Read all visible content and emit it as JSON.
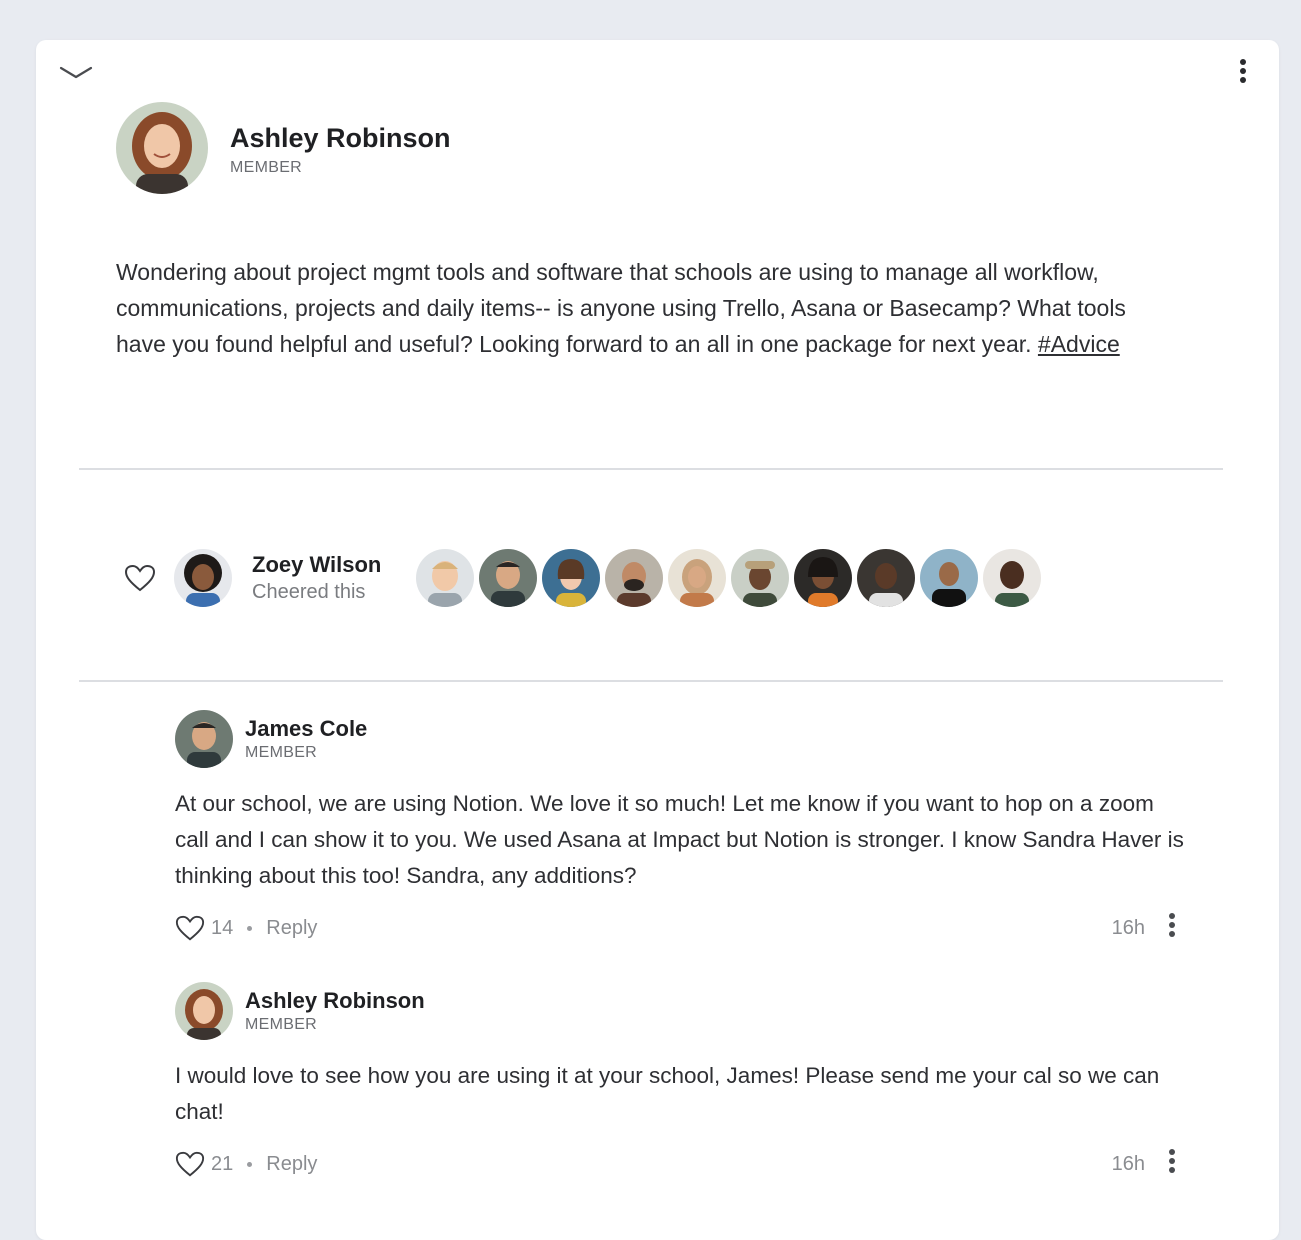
{
  "post": {
    "author": {
      "name": "Ashley Robinson",
      "role": "MEMBER"
    },
    "body": "Wondering about project mgmt tools and software that schools are using to manage all workflow, communications, projects and daily items-- is anyone using Trello, Asana or Basecamp? What tools have you found helpful and useful? Looking forward to an all in one package for next year.",
    "hashtag": "#Advice"
  },
  "cheers": {
    "name": "Zoey Wilson",
    "label": "Cheered this",
    "face_count": 10
  },
  "comments": [
    {
      "name": "James Cole",
      "role": "MEMBER",
      "body": "At our school, we are using Notion. We love it so much! Let me know if you want to hop on a zoom call and I can show it to you. We used Asana at Impact but Notion is stronger. I know Sandra Haver is thinking about this too! Sandra, any additions?",
      "likes": "14",
      "reply": "Reply",
      "time": "16h"
    },
    {
      "name": "Ashley Robinson",
      "role": "MEMBER",
      "body": "I would love to see how you are using it at your school, James! Please send me your cal so we can chat!",
      "likes": "21",
      "reply": "Reply",
      "time": "16h"
    }
  ],
  "icons": {
    "collapse": "chevron-down-icon",
    "more": "more-vertical-icon",
    "like": "heart-icon"
  },
  "colors": {
    "page_bg": "#e8ebf1",
    "card_bg": "#ffffff",
    "text": "#2e2f33",
    "muted": "#8a8c90",
    "divider": "#dcdee2"
  }
}
